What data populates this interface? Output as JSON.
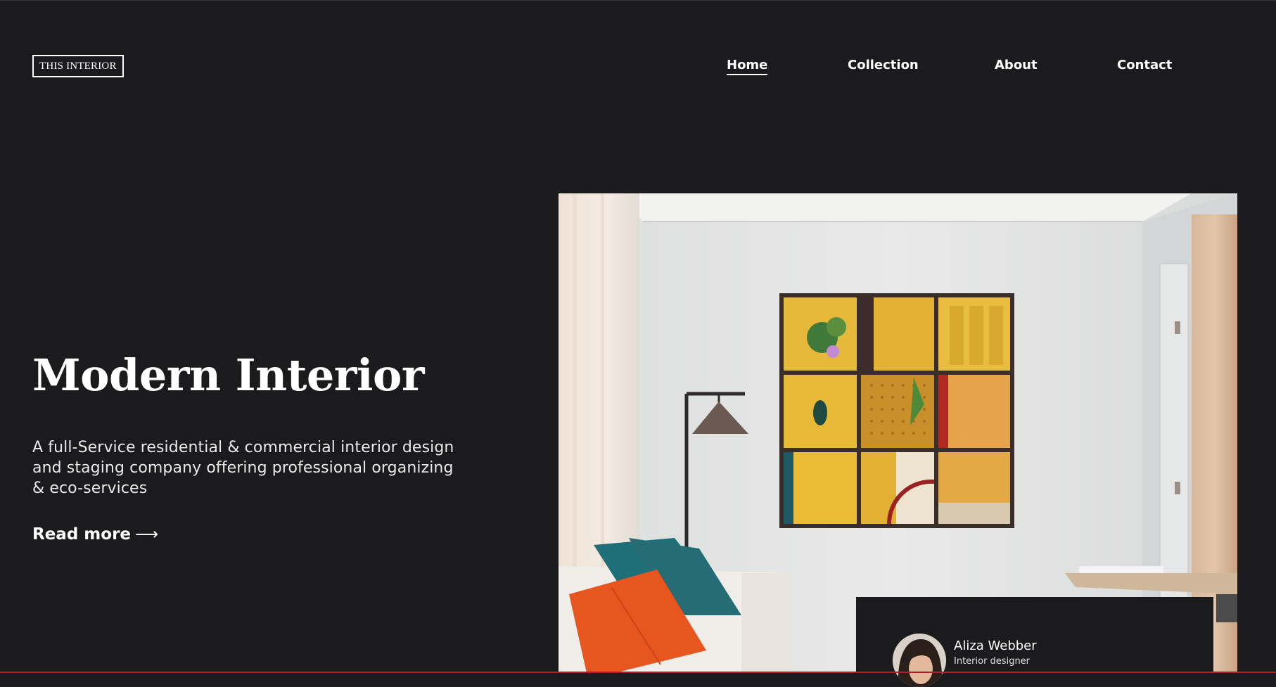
{
  "header": {
    "logo_text": "THIS INTERIOR",
    "nav": {
      "home": "Home",
      "collection": "Collection",
      "about": "About",
      "contact": "Contact"
    }
  },
  "hero": {
    "title": "Modern Interior",
    "description": "A full-Service residential & commercial interior design and staging company offering professional organizing & eco-services",
    "read_more": "Read more",
    "read_more_icon": "long-arrow-right-icon"
  },
  "designer": {
    "name": "Aliza Webber",
    "role": "Interior designer"
  },
  "colors": {
    "background": "#1b1a1d",
    "text": "#ffffff",
    "accent_bottom_line": "#b1202a"
  }
}
